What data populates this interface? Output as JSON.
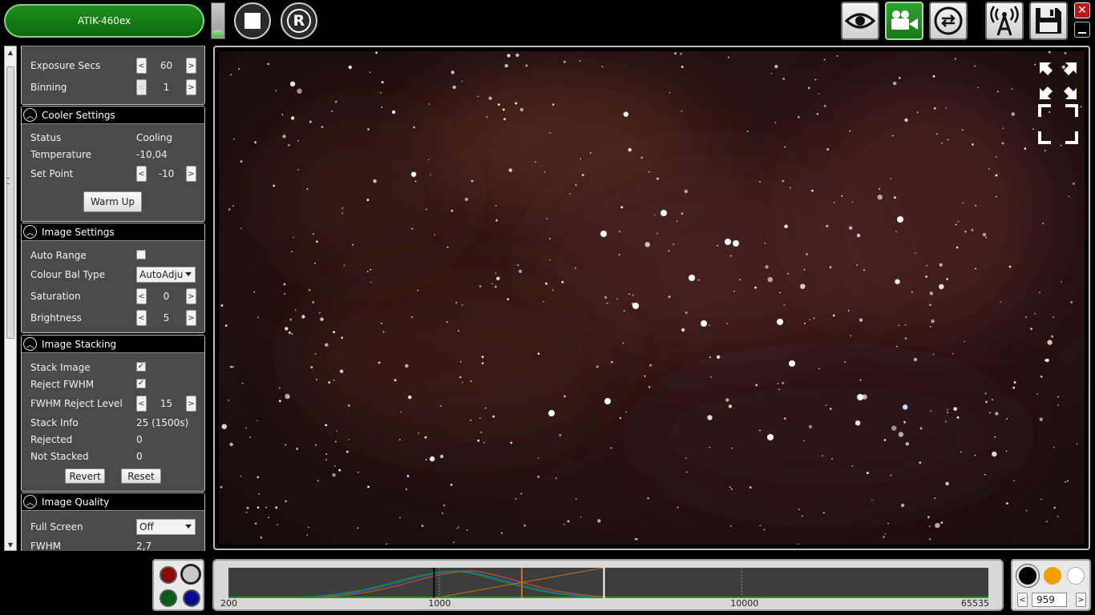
{
  "app": {
    "camera_name": "ATIK-460ex",
    "level_fraction": 0.18
  },
  "toolbar": {
    "stop": "stop-button",
    "record": "R",
    "view": "eye-icon",
    "capture": "video-camera-icon",
    "loop": "loop-icon",
    "remote": "antenna-icon",
    "save": "save-icon",
    "close": "✕"
  },
  "panels": {
    "exposure": {
      "exposure_label": "Exposure Secs",
      "exposure_value": "60",
      "binning_label": "Binning",
      "binning_value": "1"
    },
    "cooler": {
      "title": "Cooler Settings",
      "status_label": "Status",
      "status_value": "Cooling",
      "temperature_label": "Temperature",
      "temperature_value": "-10,04",
      "setpoint_label": "Set Point",
      "setpoint_value": "-10",
      "warmup_label": "Warm Up"
    },
    "image_settings": {
      "title": "Image Settings",
      "auto_range_label": "Auto Range",
      "auto_range_checked": false,
      "colour_bal_label": "Colour Bal Type",
      "colour_bal_value": "AutoAdju",
      "saturation_label": "Saturation",
      "saturation_value": "0",
      "brightness_label": "Brightness",
      "brightness_value": "5"
    },
    "stacking": {
      "title": "Image Stacking",
      "stack_image_label": "Stack Image",
      "stack_image_checked": true,
      "reject_fwhm_label": "Reject FWHM",
      "reject_fwhm_checked": true,
      "fwhm_reject_label": "FWHM Reject Level",
      "fwhm_reject_value": "15",
      "stack_info_label": "Stack Info",
      "stack_info_value": "25 (1500s)",
      "rejected_label": "Rejected",
      "rejected_value": "0",
      "not_stacked_label": "Not Stacked",
      "not_stacked_value": "0",
      "revert_label": "Revert",
      "reset_label": "Reset"
    },
    "quality": {
      "title": "Image Quality",
      "full_screen_label": "Full Screen",
      "full_screen_value": "Off",
      "fwhm_label": "FWHM",
      "fwhm_value": "2,7"
    }
  },
  "histogram": {
    "tick_labels": [
      "200",
      "1000",
      "10000",
      "65535"
    ],
    "black_point": 1000,
    "white_point": 3500
  },
  "display": {
    "value": "959",
    "dec": "<",
    "inc": ">"
  },
  "colors": {
    "accent_green": "#157a15",
    "close_red": "#c0141b",
    "channel_red": "#8b0a0a",
    "channel_green": "#0a5a18",
    "channel_blue": "#0a0a8b",
    "display_orange": "#f0a000"
  }
}
